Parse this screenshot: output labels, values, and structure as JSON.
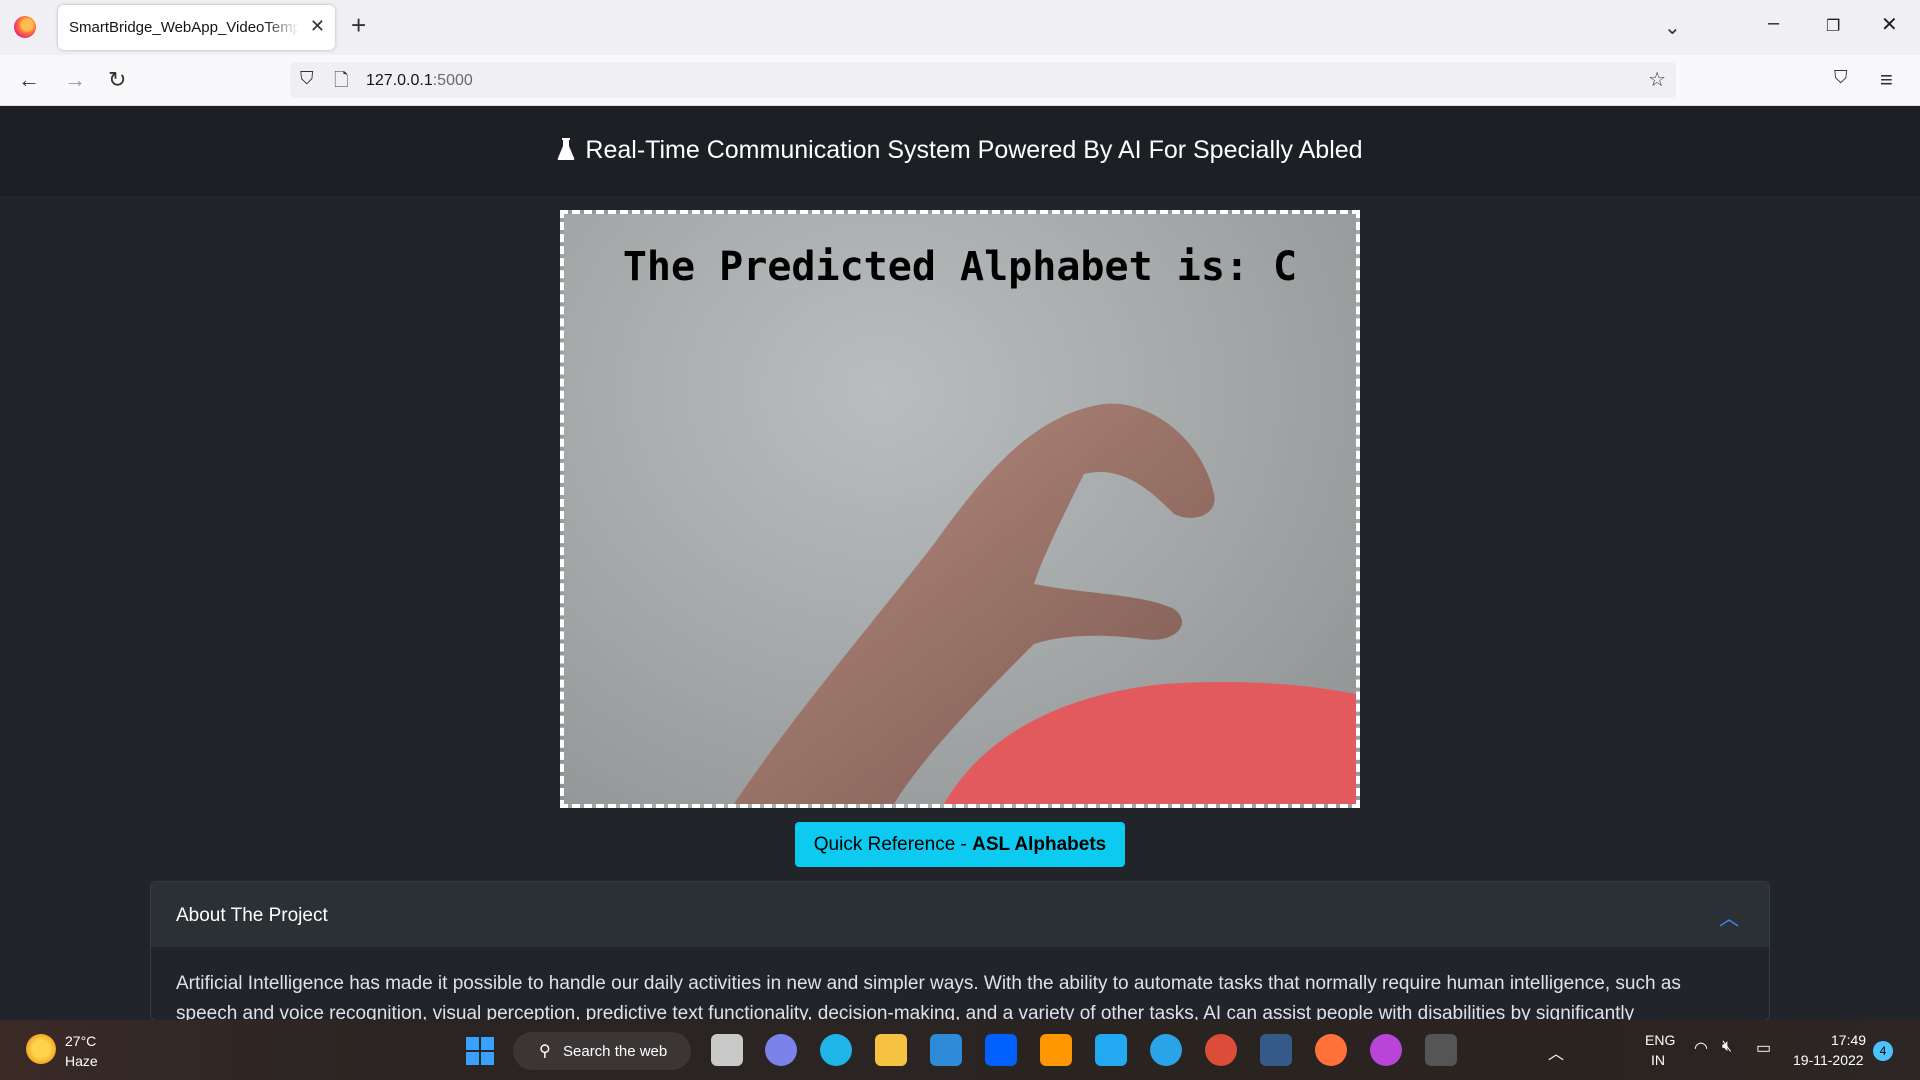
{
  "browser": {
    "tab_title": "SmartBridge_WebApp_VideoTemplate",
    "url_host": "127.0.0.1",
    "url_port": ":5000"
  },
  "page": {
    "title": "Real-Time Communication System Powered By AI For Specially Abled",
    "prediction_text": "The Predicted Alphabet is: C",
    "reference_button_prefix": "Quick Reference - ",
    "reference_button_bold": "ASL Alphabets",
    "accordion_title": "About The Project",
    "accordion_body": "Artificial Intelligence has made it possible to handle our daily activities in new and simpler ways. With the ability to automate tasks that normally require human intelligence, such as speech and voice recognition, visual perception, predictive text functionality, decision-making, and a variety of other tasks, AI can assist people with disabilities by significantly"
  },
  "taskbar": {
    "weather_temp": "27°C",
    "weather_cond": "Haze",
    "search_label": "Search the web",
    "lang_top": "ENG",
    "lang_bottom": "IN",
    "time": "17:49",
    "date": "19-11-2022",
    "notifications": "4"
  },
  "colors": {
    "page_bg": "#212529",
    "header_bg": "#1c1f23",
    "button_bg": "#0dcaf0",
    "chevron": "#3d8bfd"
  },
  "icons": [
    "firefox-icon",
    "close-icon",
    "plus-icon",
    "chevron-down-icon",
    "minimize-icon",
    "restore-icon",
    "back-icon",
    "forward-icon",
    "reload-icon",
    "shield-icon",
    "page-icon",
    "star-icon",
    "pocket-icon",
    "menu-icon",
    "flask-icon",
    "chevron-up-icon",
    "windows-start-icon",
    "search-icon"
  ]
}
